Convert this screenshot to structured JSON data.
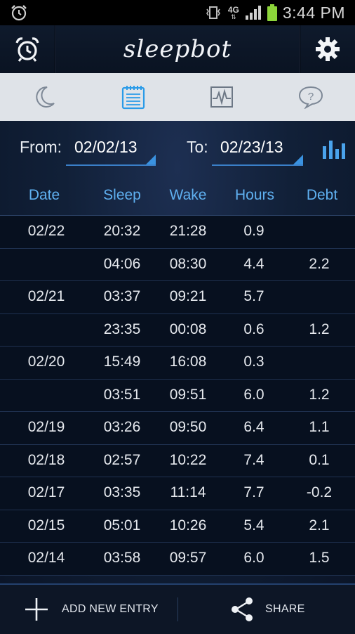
{
  "status_bar": {
    "network": "4G",
    "time": "3:44 PM"
  },
  "app_bar": {
    "logo_text": "sleepbot"
  },
  "date_range": {
    "from_label": "From:",
    "from_value": "02/02/13",
    "to_label": "To:",
    "to_value": "02/23/13"
  },
  "table": {
    "headers": [
      "Date",
      "Sleep",
      "Wake",
      "Hours",
      "Debt"
    ],
    "rows": [
      {
        "date": "02/22",
        "sleep": "20:32",
        "wake": "21:28",
        "hours": "0.9",
        "debt": ""
      },
      {
        "date": "",
        "sleep": "04:06",
        "wake": "08:30",
        "hours": "4.4",
        "debt": "2.2"
      },
      {
        "date": "02/21",
        "sleep": "03:37",
        "wake": "09:21",
        "hours": "5.7",
        "debt": ""
      },
      {
        "date": "",
        "sleep": "23:35",
        "wake": "00:08",
        "hours": "0.6",
        "debt": "1.2"
      },
      {
        "date": "02/20",
        "sleep": "15:49",
        "wake": "16:08",
        "hours": "0.3",
        "debt": ""
      },
      {
        "date": "",
        "sleep": "03:51",
        "wake": "09:51",
        "hours": "6.0",
        "debt": "1.2"
      },
      {
        "date": "02/19",
        "sleep": "03:26",
        "wake": "09:50",
        "hours": "6.4",
        "debt": "1.1"
      },
      {
        "date": "02/18",
        "sleep": "02:57",
        "wake": "10:22",
        "hours": "7.4",
        "debt": "0.1"
      },
      {
        "date": "02/17",
        "sleep": "03:35",
        "wake": "11:14",
        "hours": "7.7",
        "debt": "-0.2"
      },
      {
        "date": "02/15",
        "sleep": "05:01",
        "wake": "10:26",
        "hours": "5.4",
        "debt": "2.1"
      },
      {
        "date": "02/14",
        "sleep": "03:58",
        "wake": "09:57",
        "hours": "6.0",
        "debt": "1.5"
      }
    ]
  },
  "bottom_bar": {
    "add_label": "ADD NEW ENTRY",
    "share_label": "SHARE"
  },
  "colors": {
    "accent": "#4aa3ec",
    "header_text": "#5fb0f0",
    "tab_bg": "#dfe3e8"
  },
  "icons": {
    "status_alarm": "alarm-clock-icon",
    "alarm_button": "alarm-clock-icon",
    "settings": "gear-icon",
    "tab_sleep": "moon-icon",
    "tab_log": "notepad-icon",
    "tab_chart": "pulse-chart-icon",
    "tab_help": "help-bubble-icon",
    "chart_toggle": "bar-chart-icon",
    "add": "plus-icon",
    "share": "share-icon"
  }
}
